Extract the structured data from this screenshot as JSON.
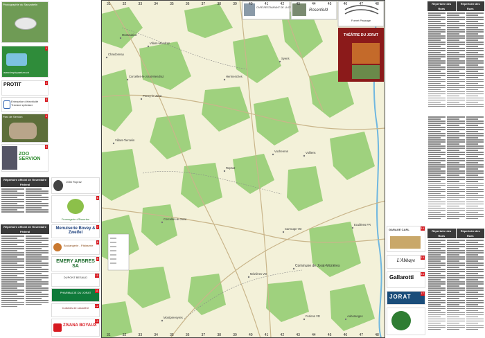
{
  "left_column": {
    "intro_caption": "Photographie du Sauvabelin",
    "ads": [
      {
        "num": "1",
        "text": "www.tropiquarium.ch"
      },
      {
        "num": "2",
        "text": "PROTIT"
      },
      {
        "num": "3",
        "text": "Entreprise d'électricité Travaux spéciaux"
      },
      {
        "num": "4",
        "text": "Parc de Servion"
      },
      {
        "num": "5",
        "text": "ZOO SERVION"
      }
    ],
    "directory_title_1": "Répertoire officiel de l'Inventaire Fédéral",
    "directory_title_2": "Répertoire officiel de l'Inventaire Fédéral"
  },
  "mid_column": {
    "ads": [
      {
        "num": "6",
        "text": "Fromagerie d'Essertes"
      },
      {
        "num": "7",
        "text": "Menuiserie Bovey & Zweifel"
      },
      {
        "num": "8",
        "text": "Boulangerie - Pâtisserie"
      },
      {
        "num": "9",
        "text": "EMERY ARBRES SA"
      },
      {
        "num": "10",
        "text": "DUPONT BESAUD"
      },
      {
        "num": "11",
        "text": "PHARMACIE DU JORAT"
      },
      {
        "num": "12",
        "text": "Cuisines de caractère"
      },
      {
        "num": "13",
        "text": "ZIVANA BOYAUX"
      }
    ],
    "small_text": "1066 Ropraz"
  },
  "map": {
    "top_ads": [
      {
        "text": "CAFÉ-RESTAURANT DE LA CROIX-D'OR"
      },
      {
        "text": "Rosenfeld"
      },
      {
        "text": "Fornet Paysage"
      },
      {
        "text": "THÉÂTRE DU JORAT"
      }
    ],
    "places": [
      {
        "name": "Montaubion"
      },
      {
        "name": "Chardonney"
      },
      {
        "name": "Villars-Mendraz"
      },
      {
        "name": "Corcelles-le-Jorat-Mendraz"
      },
      {
        "name": "Hermenches"
      },
      {
        "name": "Syens"
      },
      {
        "name": "Peney-le-Jorat"
      },
      {
        "name": "Villars-Tiercelin"
      },
      {
        "name": "Vucherens"
      },
      {
        "name": "Vulliens"
      },
      {
        "name": "Ropraz"
      },
      {
        "name": "Corcelles-le-Jorat"
      },
      {
        "name": "Carrouge VD"
      },
      {
        "name": "Ecublens FR"
      },
      {
        "name": "Mézières VD"
      },
      {
        "name": "Commune de Jorat-Mézières"
      },
      {
        "name": "Montpreveyres"
      },
      {
        "name": "Ferlens VD"
      },
      {
        "name": "Auboranges"
      }
    ],
    "grid_top": [
      "31",
      "32",
      "33",
      "34",
      "35",
      "36",
      "37",
      "38",
      "39",
      "40",
      "41",
      "42",
      "43",
      "44",
      "45",
      "46",
      "47",
      "48"
    ],
    "grid_bottom": [
      "31",
      "32",
      "33",
      "34",
      "35",
      "36",
      "37",
      "38",
      "39",
      "40",
      "41",
      "42",
      "43",
      "44",
      "45",
      "46",
      "47",
      "48"
    ],
    "colors": {
      "forest": "#9fd17e",
      "meadow": "#f3f1d9",
      "river": "#6fb7e0",
      "road": "#c9b58a"
    }
  },
  "right_ads": [
    {
      "num": "14",
      "text": "GARAGE CARL"
    },
    {
      "num": "15",
      "text": "L'Abbaye"
    },
    {
      "num": "16",
      "text": "Gallarotti"
    },
    {
      "num": "17",
      "text": "JORAT"
    }
  ],
  "right_directory": {
    "headers": [
      "Répertoire des Rues",
      "Répertoire des Rues",
      "Répertoire des Rues",
      "Répertoire des Rues"
    ]
  }
}
